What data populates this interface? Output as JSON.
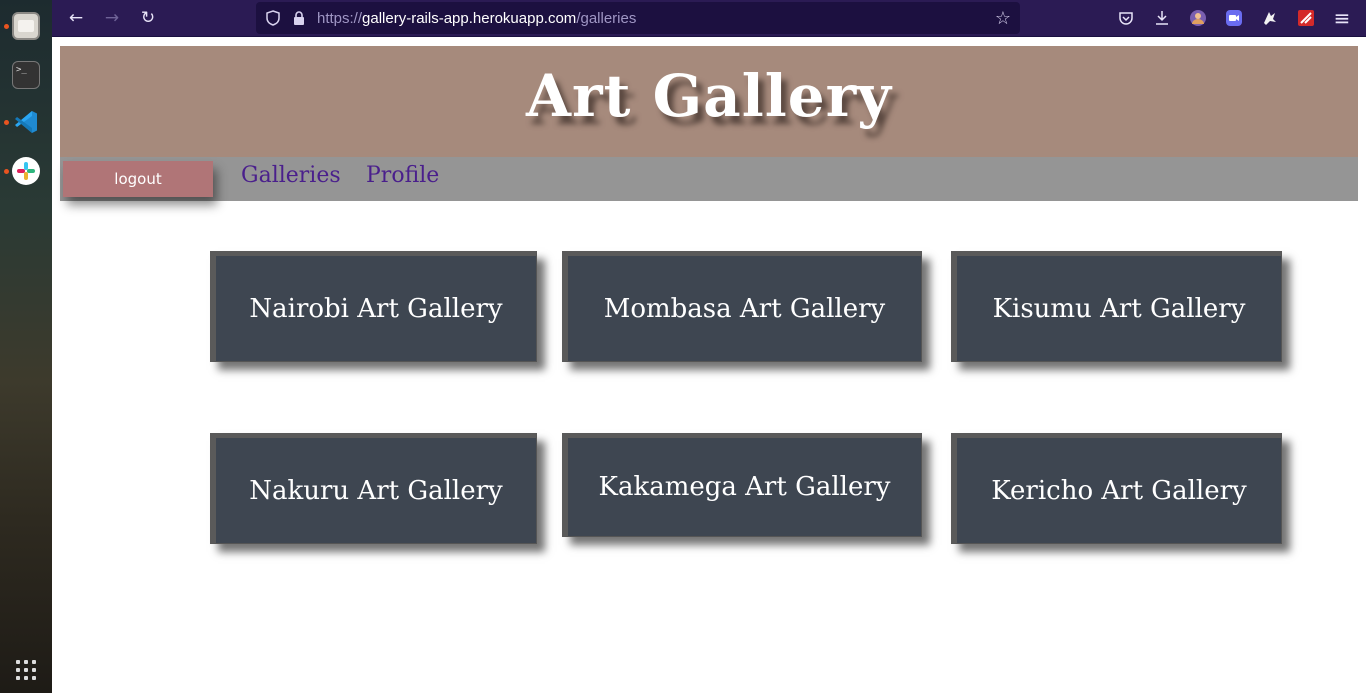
{
  "dock": {
    "items": [
      {
        "name": "files",
        "icon": "folder-icon"
      },
      {
        "name": "terminal",
        "icon": "terminal-icon",
        "glyph": ">_"
      },
      {
        "name": "vscode",
        "icon": "vscode-icon"
      },
      {
        "name": "slack",
        "icon": "slack-icon"
      }
    ],
    "apps_icon": "app-grid-icon"
  },
  "browser": {
    "url_scheme": "https://",
    "url_host": "gallery-rails-app.herokuapp.com",
    "url_path": "/galleries",
    "back_icon": "←",
    "forward_icon": "→",
    "reload_icon": "↻",
    "bookmark_icon": "☆",
    "menu_icon": "≡"
  },
  "page": {
    "title": "Art Gallery",
    "nav": {
      "logout_label": "logout",
      "galleries_label": "Galleries",
      "profile_label": "Profile"
    },
    "galleries": [
      {
        "name": "Nairobi Art Gallery"
      },
      {
        "name": "Mombasa Art Gallery"
      },
      {
        "name": "Kisumu Art Gallery"
      },
      {
        "name": "Nakuru Art Gallery"
      },
      {
        "name": "Kakamega Art Gallery"
      },
      {
        "name": "Kericho Art Gallery"
      }
    ]
  },
  "colors": {
    "banner": "#a68a7c",
    "navbar": "#959595",
    "logout_button": "#b07577",
    "card": "#3e4651",
    "nav_link": "#4a1f8c",
    "toolbar": "#2b1b54"
  }
}
